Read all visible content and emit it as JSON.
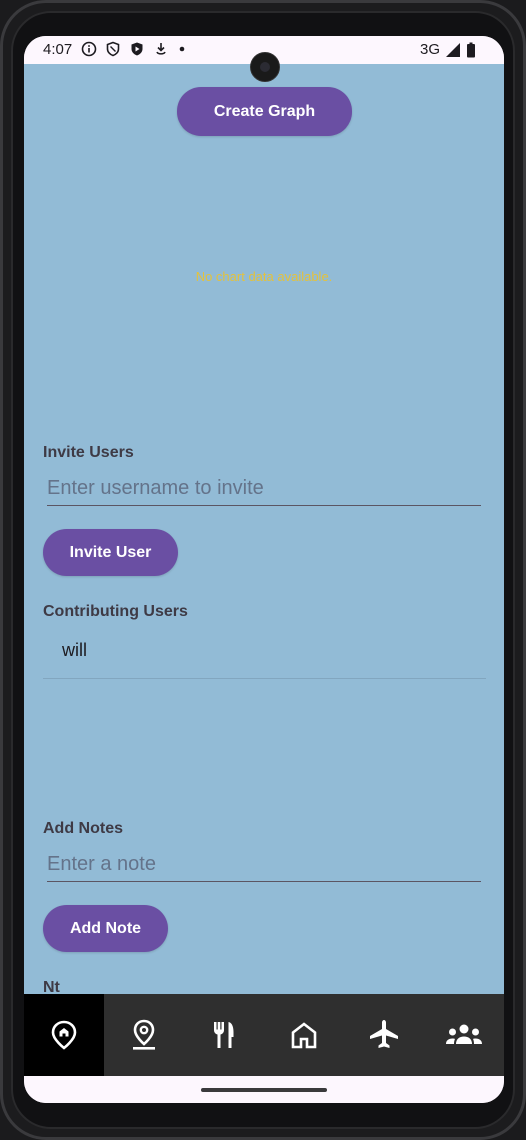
{
  "status_bar": {
    "time": "4:07",
    "network": "3G",
    "left_icons": [
      "info-icon",
      "shield-icon",
      "play-protect-icon",
      "download-icon",
      "dot-icon"
    ],
    "right_icons": [
      "signal-icon",
      "battery-icon"
    ]
  },
  "top": {
    "create_graph_label": "Create Graph",
    "no_chart_message": "No chart data available."
  },
  "invite": {
    "section_label": "Invite Users",
    "input_placeholder": "Enter username to invite",
    "button_label": "Invite User"
  },
  "contributors": {
    "section_label": "Contributing Users",
    "users": [
      "will"
    ]
  },
  "notes": {
    "section_label": "Add Notes",
    "input_placeholder": "Enter a note",
    "button_label": "Add Note",
    "list_label_partial": "Nt"
  },
  "bottom_nav": {
    "items": [
      {
        "icon": "home-pin-icon",
        "active": true
      },
      {
        "icon": "location-pin-icon",
        "active": false
      },
      {
        "icon": "restaurant-icon",
        "active": false
      },
      {
        "icon": "house-icon",
        "active": false
      },
      {
        "icon": "airplane-icon",
        "active": false
      },
      {
        "icon": "group-icon",
        "active": false
      }
    ]
  },
  "colors": {
    "content_background": "#92bbd6",
    "primary_button": "#6a4fa3",
    "nav_background": "#2f2f2f",
    "nav_active": "#000000",
    "empty_chart_text": "#e3c23d"
  }
}
